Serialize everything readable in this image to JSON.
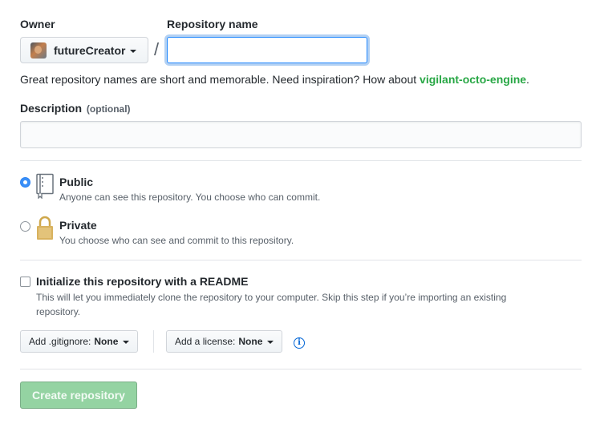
{
  "owner": {
    "label": "Owner",
    "name": "futureCreator"
  },
  "repo_name": {
    "label": "Repository name",
    "value": "",
    "placeholder": "",
    "separator": "/"
  },
  "hint": {
    "text": "Great repository names are short and memorable. Need inspiration? How about",
    "suggestion": "vigilant-octo-engine",
    "end": "."
  },
  "description": {
    "label": "Description",
    "optional": "(optional)",
    "value": ""
  },
  "visibility": {
    "selected": "public",
    "options": [
      {
        "title": "Public",
        "note": "Anyone can see this repository. You choose who can commit.",
        "icon": "repo-book-icon"
      },
      {
        "title": "Private",
        "note": "You choose who can see and commit to this repository.",
        "icon": "lock-icon"
      }
    ]
  },
  "readme": {
    "checked": false,
    "label": "Initialize this repository with a README",
    "note": "This will let you immediately clone the repository to your computer. Skip this step if you’re importing an existing repository."
  },
  "gitignore": {
    "label": "Add .gitignore:",
    "value": "None"
  },
  "license": {
    "label": "Add a license:",
    "value": "None",
    "info_icon": "info-icon"
  },
  "submit": {
    "label": "Create repository",
    "disabled": true
  },
  "colors": {
    "accent": "#2188ff",
    "suggestion": "#28a745",
    "submit_disabled": "#94d3a2",
    "lock": "#cfa84c"
  }
}
